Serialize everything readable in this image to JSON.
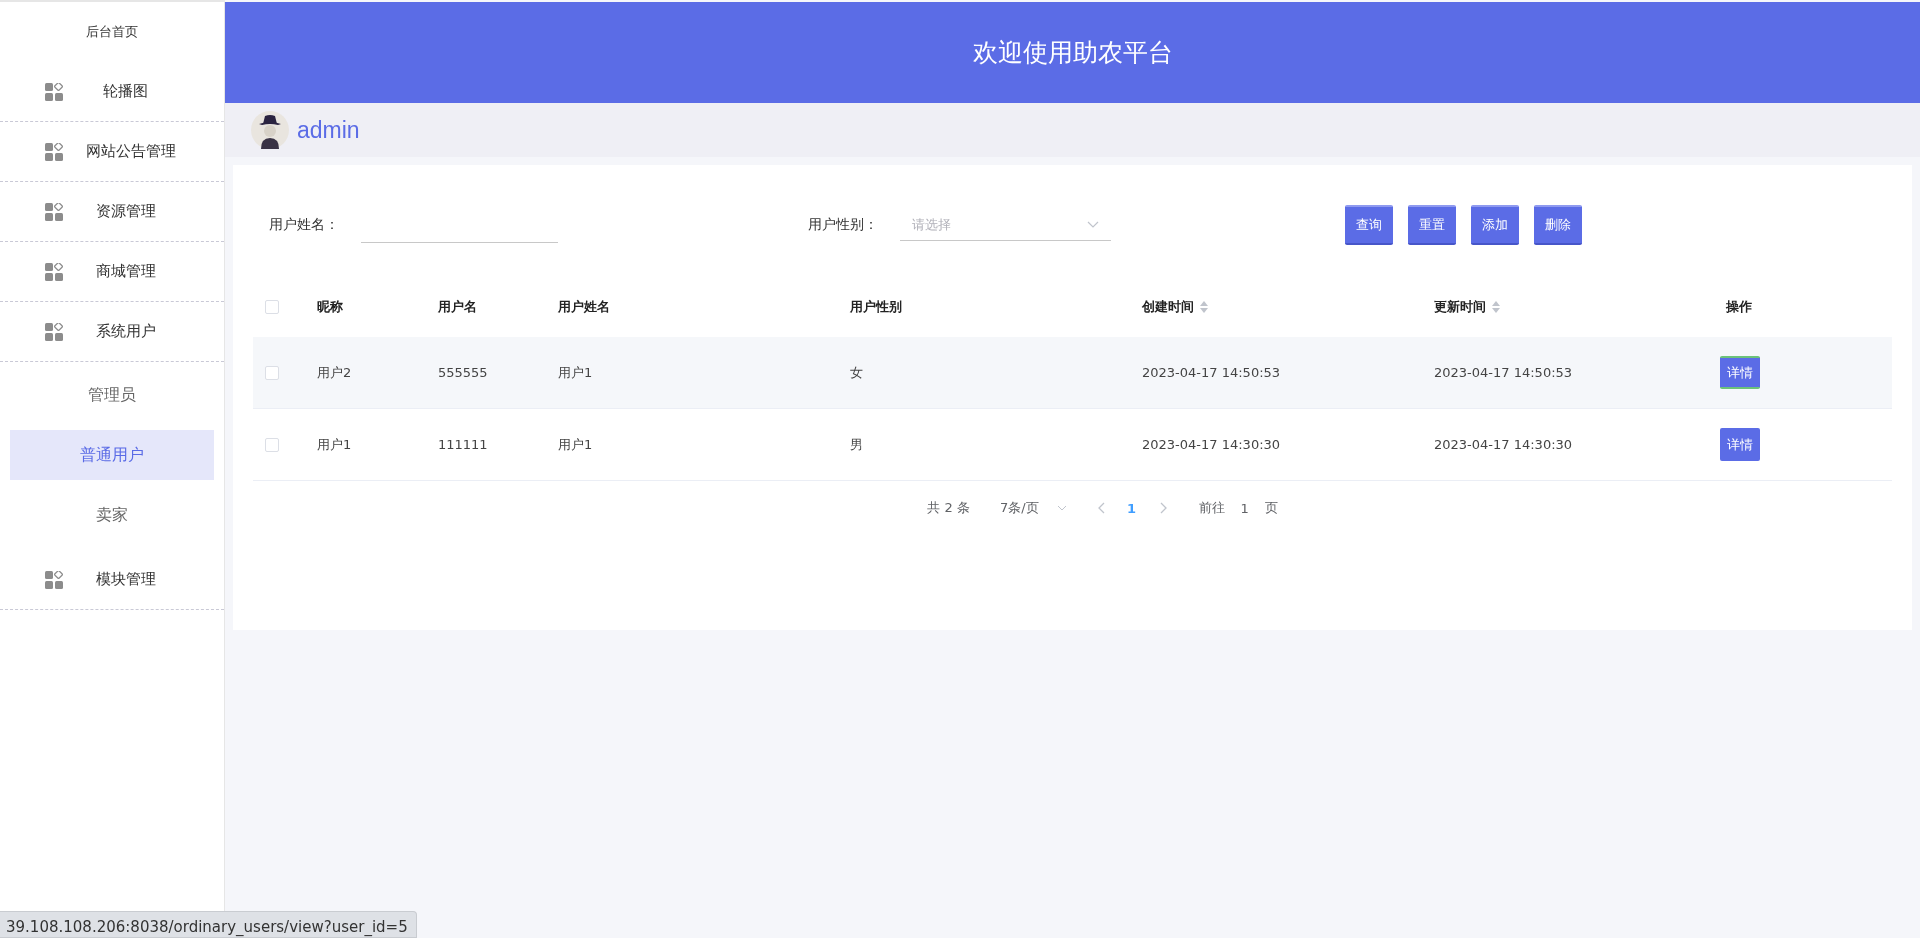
{
  "sidebar": {
    "items": [
      {
        "label": "后台首页",
        "kind": "home"
      },
      {
        "label": "轮播图",
        "kind": "group"
      },
      {
        "label": "网站公告管理",
        "kind": "group"
      },
      {
        "label": "资源管理",
        "kind": "group"
      },
      {
        "label": "商城管理",
        "kind": "group"
      },
      {
        "label": "系统用户",
        "kind": "group",
        "children": [
          {
            "label": "管理员",
            "selected": false
          },
          {
            "label": "普通用户",
            "selected": true
          },
          {
            "label": "卖家",
            "selected": false
          }
        ]
      },
      {
        "label": "模块管理",
        "kind": "group"
      }
    ]
  },
  "header": {
    "title": "欢迎使用助农平台"
  },
  "user": {
    "name": "admin"
  },
  "filters": {
    "name_label": "用户姓名：",
    "gender_label": "用户性别：",
    "gender_placeholder": "请选择",
    "buttons": [
      "查询",
      "重置",
      "添加",
      "删除"
    ]
  },
  "table": {
    "header_checked": false,
    "columns": [
      {
        "label": "昵称",
        "sortable": false
      },
      {
        "label": "用户名",
        "sortable": false
      },
      {
        "label": "用户姓名",
        "sortable": false
      },
      {
        "label": "用户性别",
        "sortable": false
      },
      {
        "label": "创建时间",
        "sortable": true
      },
      {
        "label": "更新时间",
        "sortable": true
      },
      {
        "label": "操作",
        "sortable": false
      }
    ],
    "rows": [
      {
        "checked": false,
        "hovered": true,
        "cells": [
          "用户2",
          "555555",
          "用户1",
          "女",
          "2023-04-17 14:50:53",
          "2023-04-17 14:50:53"
        ],
        "action": "详情"
      },
      {
        "checked": false,
        "hovered": false,
        "cells": [
          "用户1",
          "111111",
          "用户1",
          "男",
          "2023-04-17 14:30:30",
          "2023-04-17 14:30:30"
        ],
        "action": "详情"
      }
    ]
  },
  "pagination": {
    "total": "共 2 条",
    "page_size": "7条/页",
    "pages": [
      {
        "label": "1",
        "selected": true
      }
    ],
    "goto_label": "前往",
    "goto_value": "1",
    "goto_suffix": "页"
  },
  "status_bar": {
    "url": "39.108.108.206:8038/ordinary_users/view?user_id=5"
  }
}
